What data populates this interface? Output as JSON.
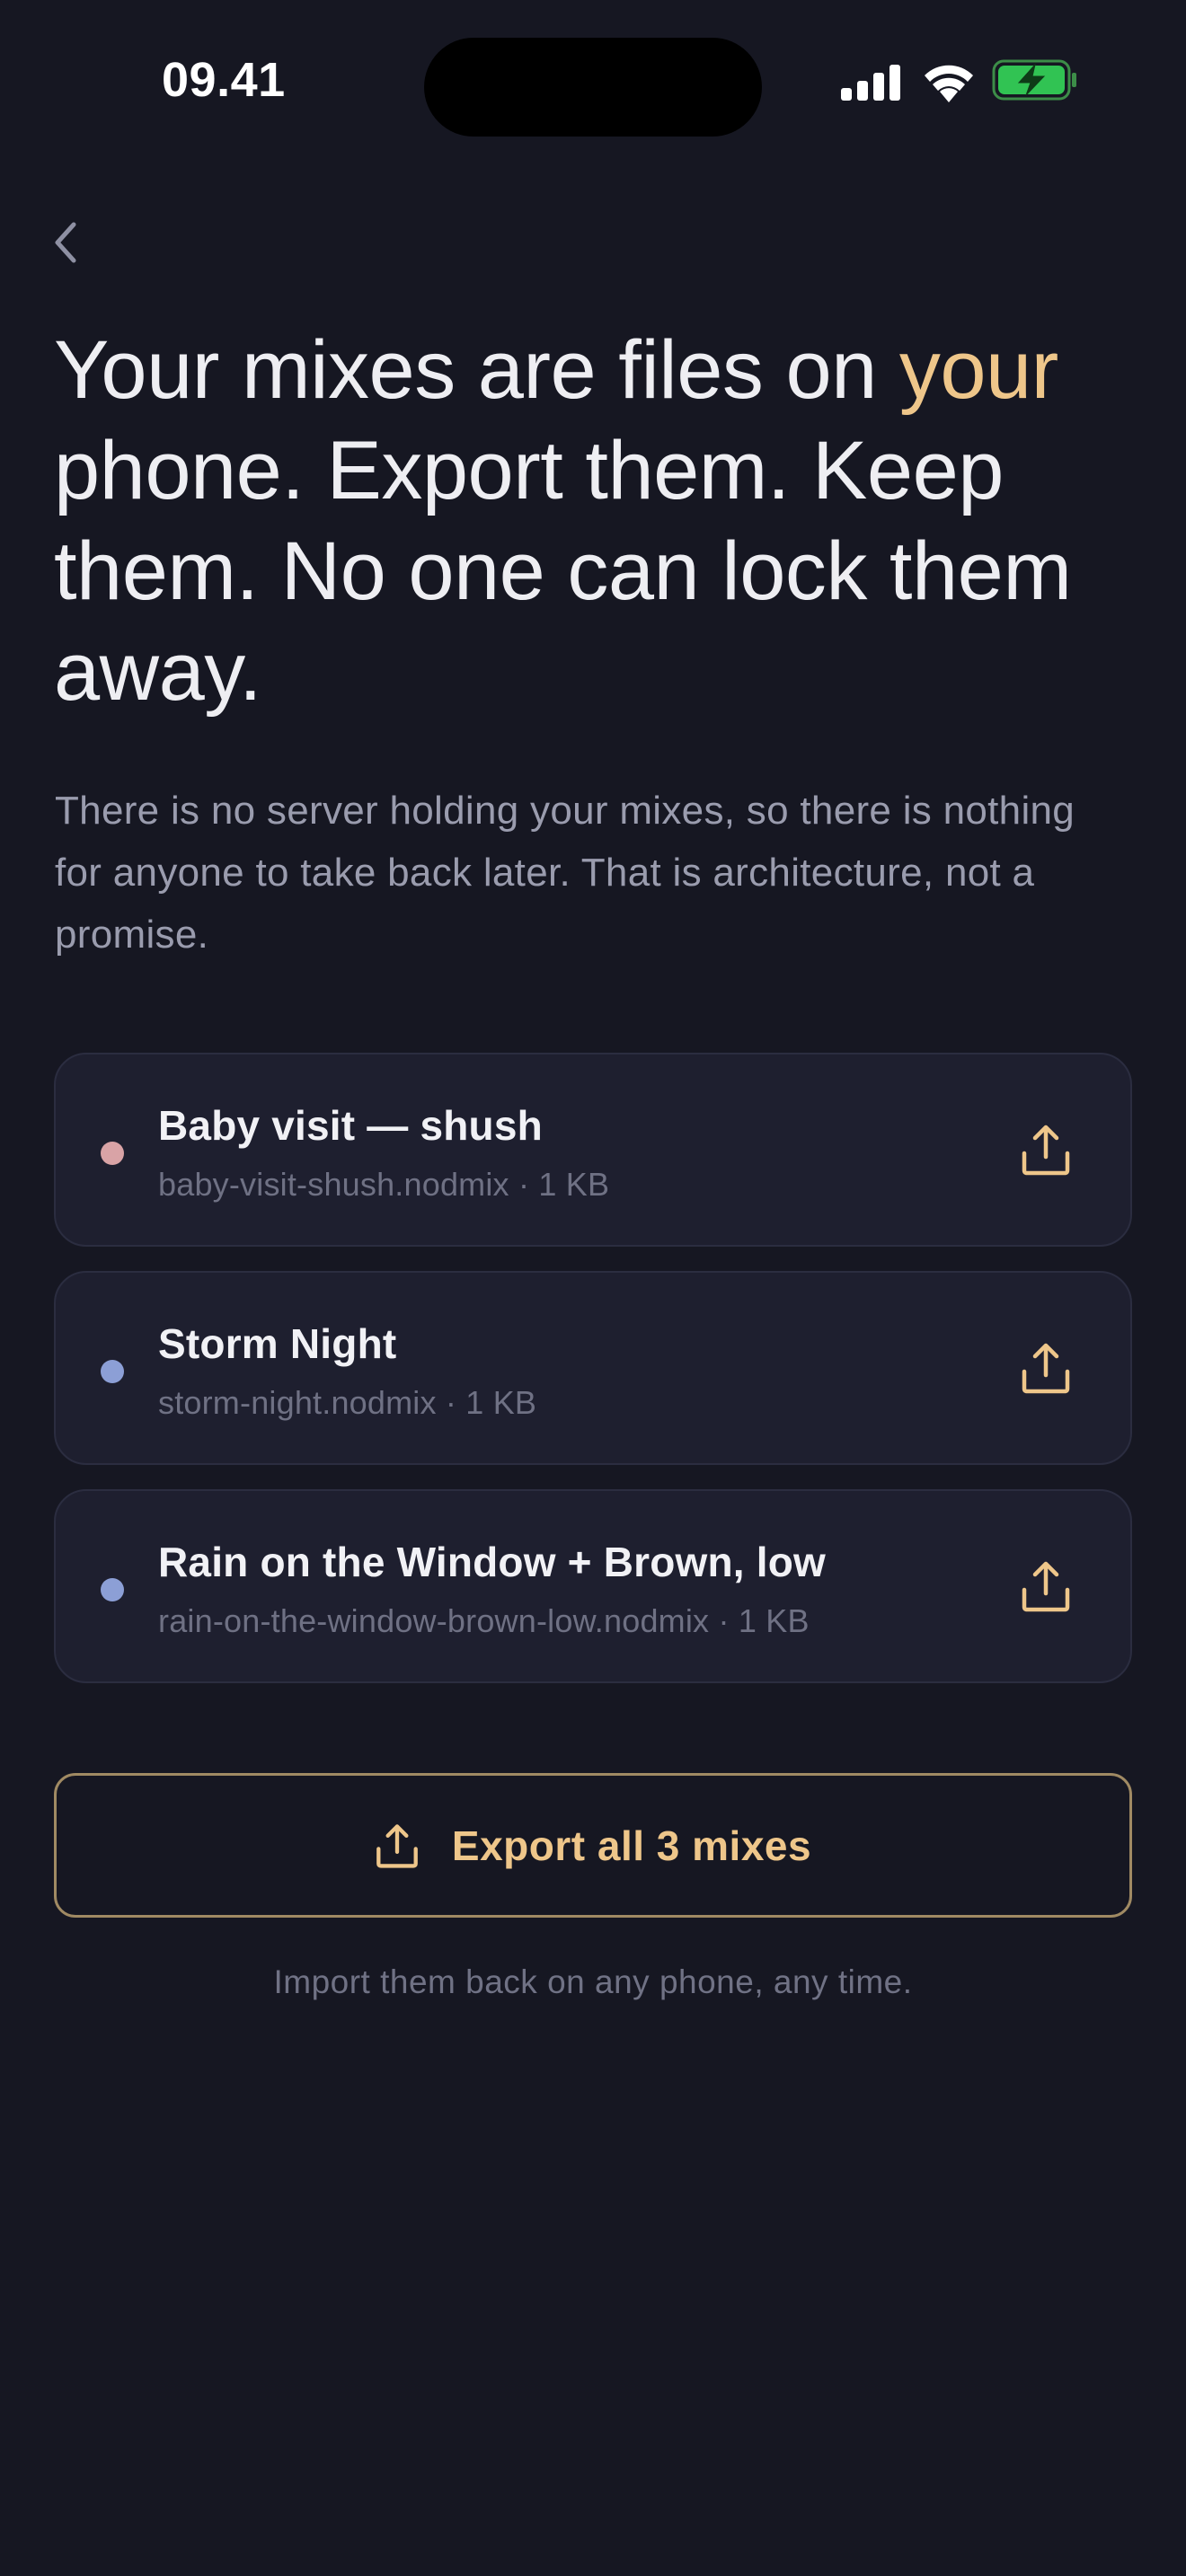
{
  "status_bar": {
    "time": "09.41"
  },
  "nav": {
    "back_icon": "chevron-left-icon"
  },
  "headline": {
    "before_accent": "Your mixes are files on ",
    "accent": "your",
    "after_accent": " phone. Export them. Keep them. No one can lock them away."
  },
  "subtext": "There is no server holding your mixes, so there is nothing for anyone to take back later. That is architecture, not a promise.",
  "mixes": [
    {
      "name": "Baby visit — shush",
      "meta": "baby-visit-shush.nodmix · 1 KB",
      "dot_color": "#d9a3a6",
      "icon": "share-upload-icon"
    },
    {
      "name": "Storm Night",
      "meta": "storm-night.nodmix · 1 KB",
      "dot_color": "#8c9fd6",
      "icon": "share-upload-icon"
    },
    {
      "name": "Rain on the Window + Brown, low",
      "meta": "rain-on-the-window-brown-low.nodmix · 1 KB",
      "dot_color": "#8c9fd6",
      "icon": "share-upload-icon"
    }
  ],
  "export_all": {
    "label": "Export all 3 mixes",
    "icon": "share-upload-icon"
  },
  "footnote": "Import them back on any phone, any time.",
  "colors": {
    "background": "#161722",
    "accent": "#eec68a",
    "card": "#1e1f2f"
  }
}
